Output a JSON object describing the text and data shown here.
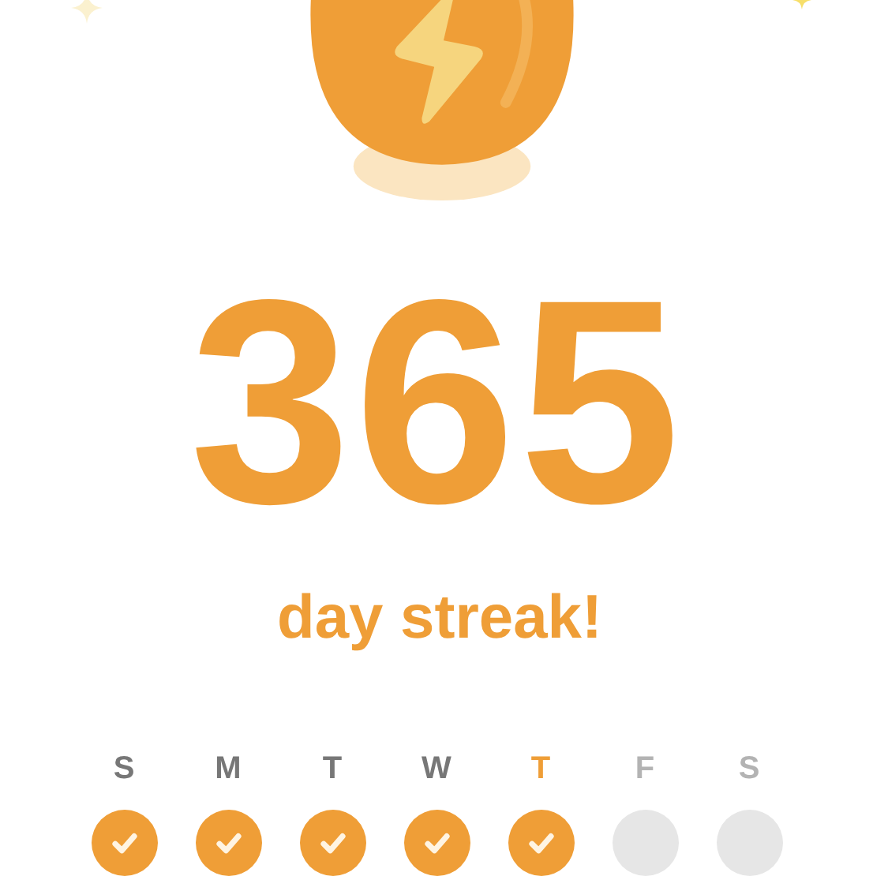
{
  "streak": {
    "count": "365",
    "caption": "day streak!"
  },
  "days": [
    {
      "label": "S",
      "checked": true,
      "selected": false
    },
    {
      "label": "M",
      "checked": true,
      "selected": false
    },
    {
      "label": "T",
      "checked": true,
      "selected": false
    },
    {
      "label": "W",
      "checked": true,
      "selected": false
    },
    {
      "label": "T",
      "checked": true,
      "selected": true
    },
    {
      "label": "F",
      "checked": false,
      "selected": false
    },
    {
      "label": "S",
      "checked": false,
      "selected": false
    }
  ]
}
